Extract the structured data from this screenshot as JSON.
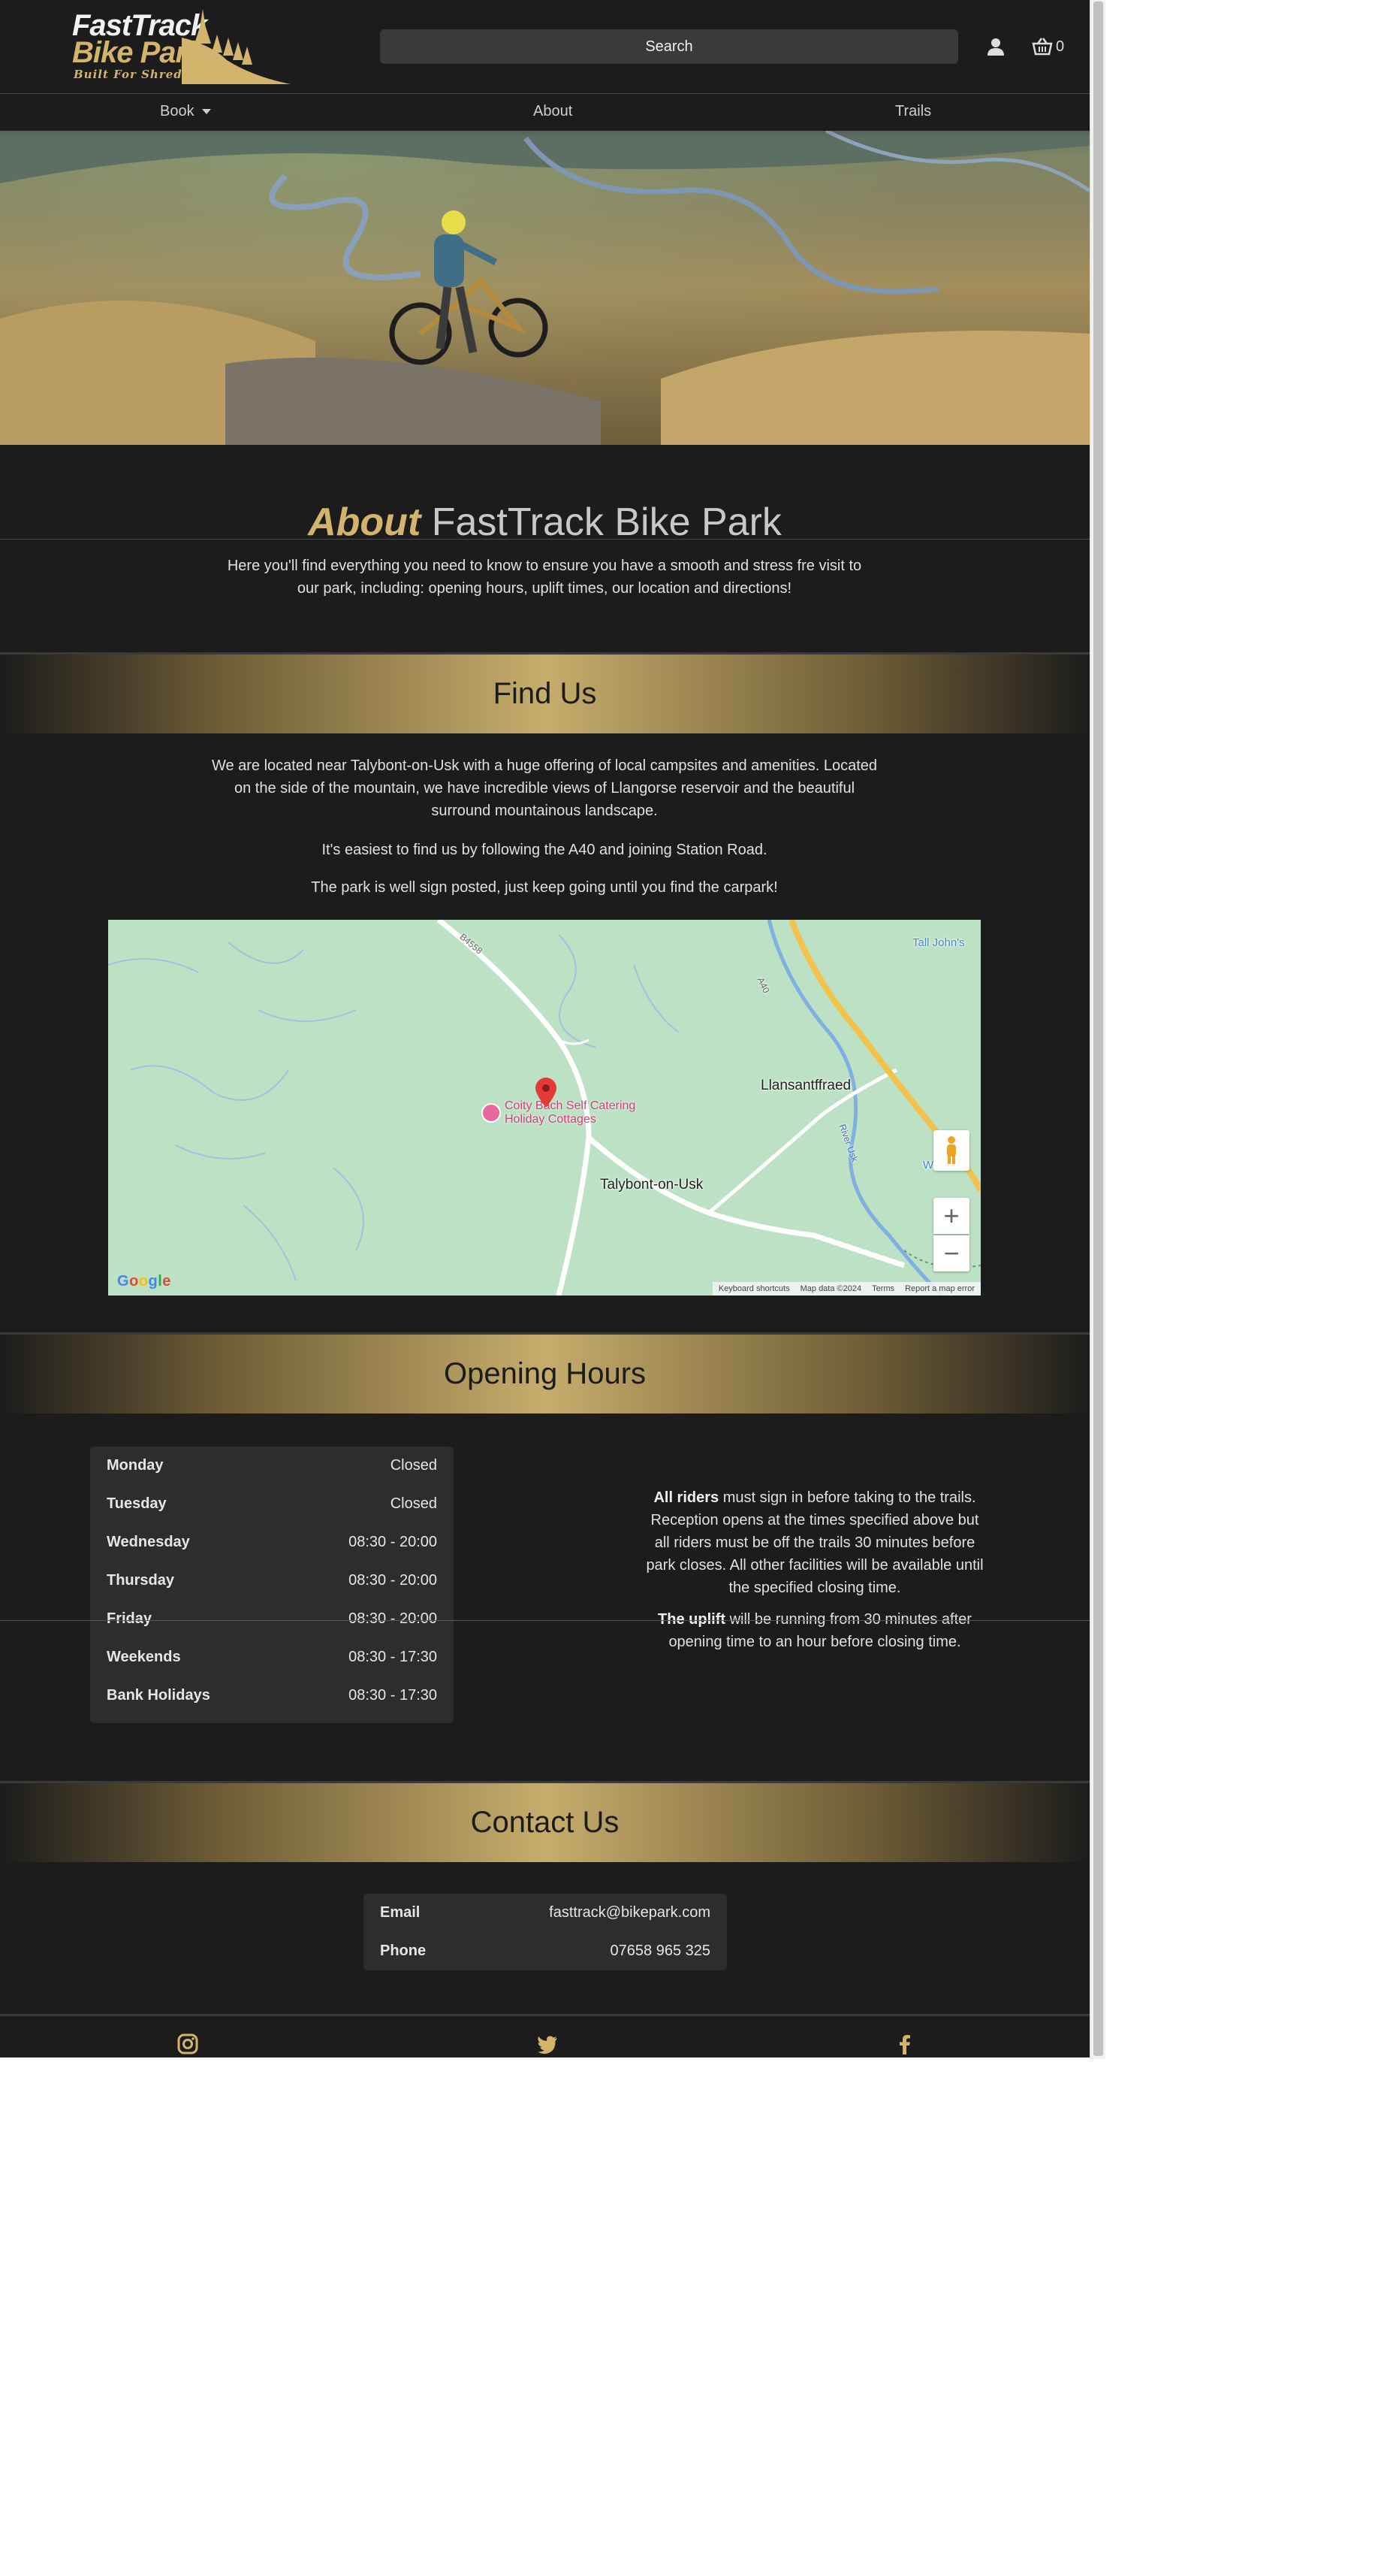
{
  "brand": {
    "name_line1": "FastTrack",
    "name_line2": "Bike Park",
    "tagline": "Built For Shredding",
    "colors": {
      "gold": "#d2b46c",
      "background": "#1c1c1c",
      "panel": "#2d2d2d"
    }
  },
  "header": {
    "search_label": "Search",
    "user_icon": "user-icon",
    "cart_icon": "basket-icon",
    "cart_count": "0"
  },
  "nav": {
    "items": [
      {
        "label": "Book",
        "has_dropdown": true
      },
      {
        "label": "About"
      },
      {
        "label": "Trails"
      }
    ]
  },
  "hero": {
    "image": "rider with mountain bike overlooking a winding river valley"
  },
  "about": {
    "title_em": "About",
    "title_rest": "FastTrack Bike Park",
    "description": "Here you'll find everything you need to know to ensure you have a smooth and stress fre visit to our park, including: opening hours, uplift times, our location and directions!"
  },
  "find_us": {
    "heading": "Find Us",
    "paragraphs": [
      "We are located near Talybont-on-Usk with a huge offering of local campsites and amenities. Located on the side of the mountain, we have incredible views of Llangorse reservoir and the beautiful surround mountainous landscape.",
      "It's easiest to find us by following the A40 and joining Station Road.",
      "The park is well sign posted, just keep going until you find the carpark!"
    ]
  },
  "map": {
    "labels": {
      "village1": "Llansantffraed",
      "village2": "Talybont-on-Usk",
      "corner": "Tall John's",
      "poi_line1": "Coity Bach Self Catering",
      "poi_line2": "Holiday Cottages",
      "road_b": "B4558",
      "road_a": "A40",
      "river": "River Usk",
      "edge": "Wet..."
    },
    "google": "Google",
    "footer": [
      "Keyboard shortcuts",
      "Map data ©2024",
      "Terms",
      "Report a map error"
    ],
    "zoom_in": "+",
    "zoom_out": "−"
  },
  "opening_hours": {
    "heading": "Opening Hours",
    "rows": [
      {
        "day": "Monday",
        "time": "Closed"
      },
      {
        "day": "Tuesday",
        "time": "Closed"
      },
      {
        "day": "Wednesday",
        "time": "08:30 - 20:00"
      },
      {
        "day": "Thursday",
        "time": "08:30 - 20:00"
      },
      {
        "day": "Friday",
        "time": "08:30 - 20:00"
      },
      {
        "day": "Weekends",
        "time": "08:30 - 17:30"
      },
      {
        "day": "Bank Holidays",
        "time": "08:30 - 17:30"
      }
    ],
    "info_strong1": "All riders",
    "info_text1": " must sign in before taking to the trails. Reception opens at the times specified above but all riders must be off the trails 30 minutes before park closes. All other facilities will be available until the specified closing time.",
    "info_strong2": "The uplift",
    "info_text2": " will be running from 30 minutes after opening time to an hour before closing time."
  },
  "contact": {
    "heading": "Contact Us",
    "rows": [
      {
        "key": "Email",
        "value": "fasttrack@bikepark.com"
      },
      {
        "key": "Phone",
        "value": "07658 965 325"
      }
    ]
  },
  "footer": {
    "icons": [
      "instagram-icon",
      "twitter-icon",
      "facebook-icon"
    ]
  }
}
